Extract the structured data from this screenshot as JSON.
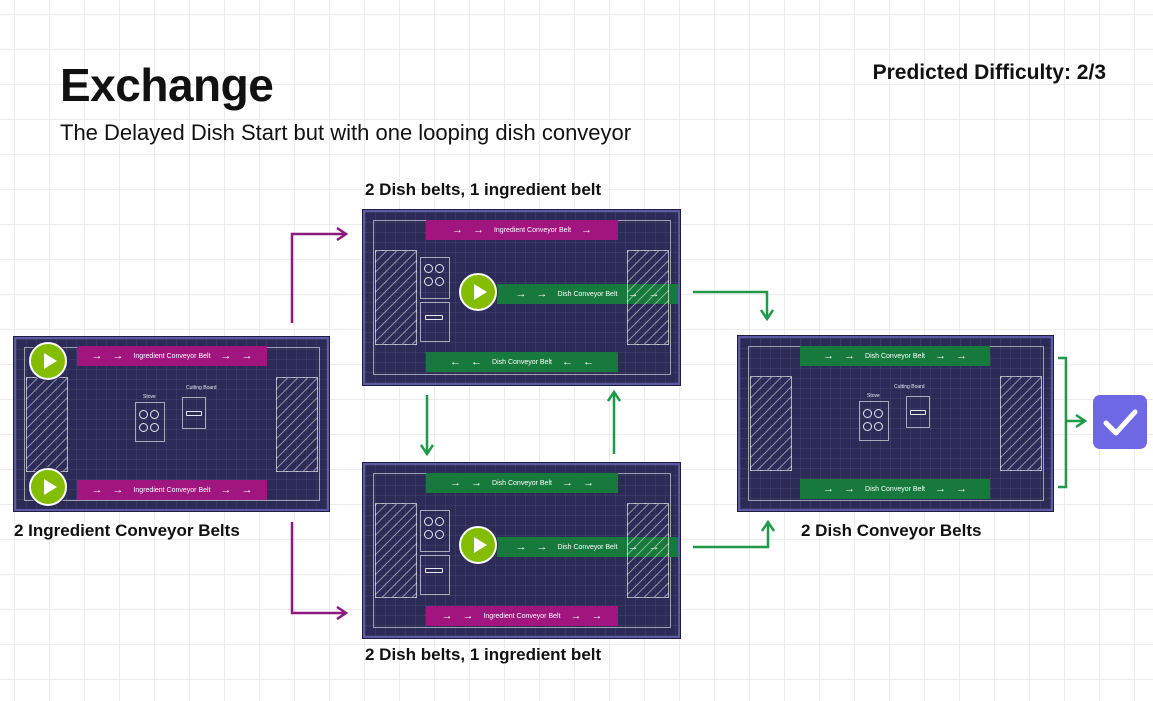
{
  "title": "Exchange",
  "subtitle": "The Delayed Dish Start but with one looping dish conveyor",
  "difficulty": "Predicted Difficulty: 2/3",
  "captions": {
    "left": "2 Ingredient Conveyor Belts",
    "top_middle": "2 Dish belts, 1 ingredient belt",
    "bottom_middle": "2 Dish belts, 1 ingredient belt",
    "right": "2 Dish Conveyor Belts"
  },
  "belt_labels": {
    "ingredient": "Ingredient Conveyor Belt",
    "dish": "Dish Conveyor Belt"
  },
  "station_labels": {
    "stove": "Stove",
    "cutting_board": "Cutting Board"
  },
  "colors": {
    "ingredient_belt": "#a1157f",
    "dish_belt": "#177a3c",
    "kitchen_floor": "#2c2b58",
    "play": "#84bd00",
    "done": "#6e68e5",
    "arrow_purple": "#8b1a7e",
    "arrow_green": "#1f9a4a"
  },
  "icons": [
    "play-icon",
    "checkmark-icon",
    "arrow-icon"
  ]
}
